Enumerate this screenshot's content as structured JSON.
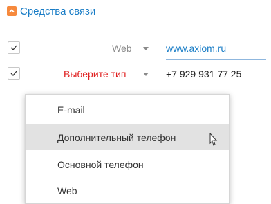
{
  "section": {
    "title": "Средства связи"
  },
  "rows": [
    {
      "type_label": "Web",
      "value": "www.axiom.ru",
      "checked": true
    },
    {
      "type_label": "Выберите тип",
      "value": "+7 929 931 77 25",
      "checked": true
    }
  ],
  "dropdown": {
    "options": [
      "E-mail",
      "Дополнительный телефон",
      "Основной телефон",
      "Web"
    ],
    "hovered": "Дополнительный телефон"
  },
  "colors": {
    "accent": "#1a7dc6",
    "warning": "#e02020",
    "collapse_icon": "#f6893d",
    "hover": "#e2e2e2"
  }
}
